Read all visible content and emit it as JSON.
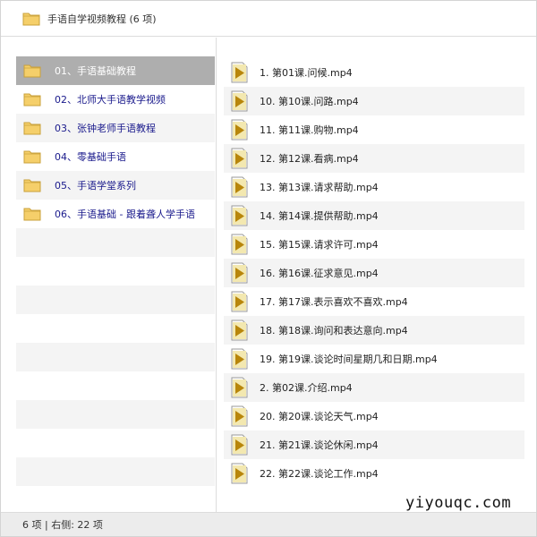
{
  "window": {
    "title": "手语自学视频教程 (6 项)"
  },
  "left_pane": {
    "items": [
      {
        "label": "01、手语基础教程",
        "selected": true
      },
      {
        "label": "02、北师大手语教学视频",
        "selected": false
      },
      {
        "label": "03、张钟老师手语教程",
        "selected": false
      },
      {
        "label": "04、零基础手语",
        "selected": false
      },
      {
        "label": "05、手语学堂系列",
        "selected": false
      },
      {
        "label": "06、手语基础 - 跟着聋人学手语",
        "selected": false
      }
    ]
  },
  "right_pane": {
    "items": [
      {
        "label": "1. 第01课.问候.mp4"
      },
      {
        "label": "10. 第10课.问路.mp4"
      },
      {
        "label": "11. 第11课.购物.mp4"
      },
      {
        "label": "12. 第12课.看病.mp4"
      },
      {
        "label": "13. 第13课.请求帮助.mp4"
      },
      {
        "label": "14. 第14课.提供帮助.mp4"
      },
      {
        "label": "15. 第15课.请求许可.mp4"
      },
      {
        "label": "16. 第16课.征求意见.mp4"
      },
      {
        "label": "17. 第17课.表示喜欢不喜欢.mp4"
      },
      {
        "label": "18. 第18课.询问和表达意向.mp4"
      },
      {
        "label": "19. 第19课.谈论时间星期几和日期.mp4"
      },
      {
        "label": "2. 第02课.介绍.mp4"
      },
      {
        "label": "20. 第20课.谈论天气.mp4"
      },
      {
        "label": "21. 第21课.谈论休闲.mp4"
      },
      {
        "label": "22. 第22课.谈论工作.mp4"
      }
    ]
  },
  "status_bar": {
    "text": "6 项 | 右侧: 22 项"
  },
  "watermark": {
    "text": "yiyouqc.com"
  },
  "colors": {
    "folder_fill": "#f5cf6a",
    "folder_border": "#c9a03a",
    "media_fill": "#f3e8b0",
    "media_triangle": "#b8860b",
    "link_text": "#1a1a8c",
    "selected_bg": "#aeaeae"
  },
  "icons": {
    "folder": "folder-icon",
    "media": "media-file-icon"
  }
}
